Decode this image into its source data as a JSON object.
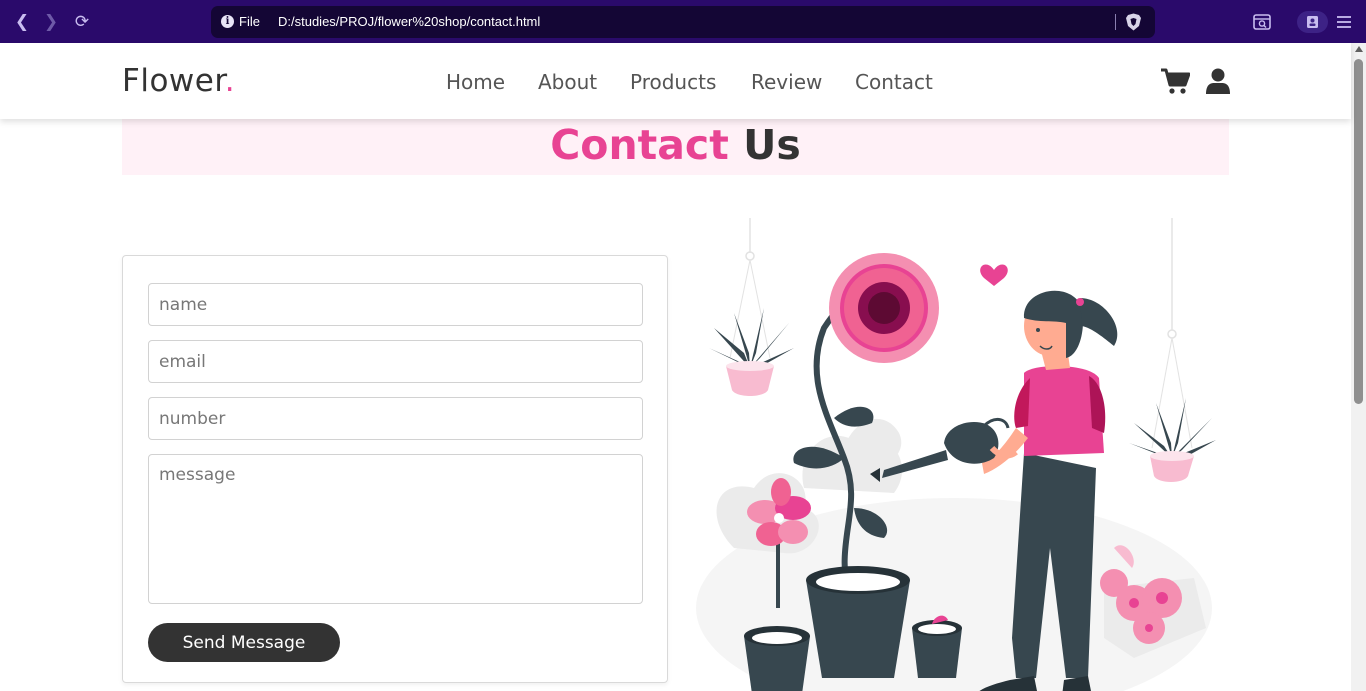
{
  "browser": {
    "file_label": "File",
    "url": "D:/studies/PROJ/flower%20shop/contact.html"
  },
  "header": {
    "logo_text": "Flower",
    "logo_dot": ".",
    "nav": [
      "Home",
      "About",
      "Products",
      "Review",
      "Contact"
    ],
    "icons": [
      "cart-icon",
      "user-icon"
    ]
  },
  "heading": {
    "highlight": "Contact",
    "rest": "Us"
  },
  "form": {
    "name_placeholder": "name",
    "email_placeholder": "email",
    "number_placeholder": "number",
    "message_placeholder": "message",
    "submit_label": "Send Message"
  },
  "colors": {
    "accent": "#e84393",
    "dark": "#333333",
    "heading_band": "#fff1f7",
    "browser_bar": "#2a0a6b"
  }
}
